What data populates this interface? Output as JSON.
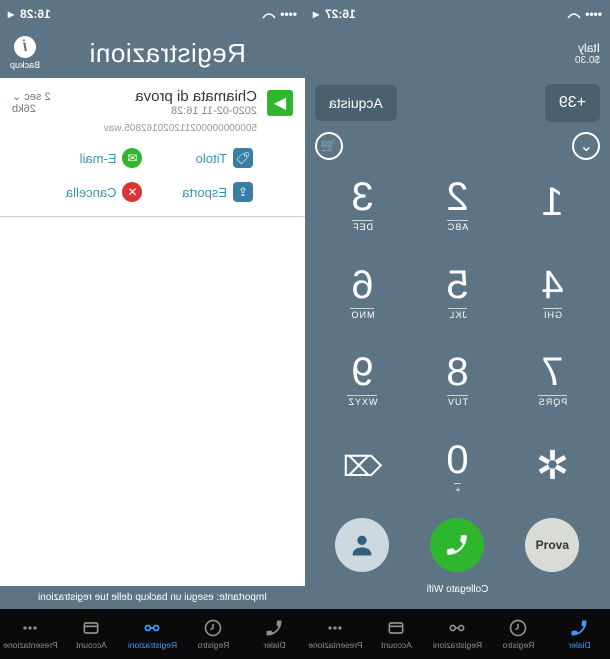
{
  "dialer_screen": {
    "statusbar": {
      "carrier_dots": "•••",
      "wifi": true,
      "time": "16:27",
      "signal": true,
      "battery": true
    },
    "country": "Italy",
    "balance": "$0.30",
    "prefix_btn": "+39",
    "buy_btn": "Acquista",
    "keys": [
      {
        "d": "1",
        "l": ""
      },
      {
        "d": "2",
        "l": "ABC"
      },
      {
        "d": "3",
        "l": "DEF"
      },
      {
        "d": "4",
        "l": "GHI"
      },
      {
        "d": "5",
        "l": "JKL"
      },
      {
        "d": "6",
        "l": "MNO"
      },
      {
        "d": "7",
        "l": "PQRS"
      },
      {
        "d": "8",
        "l": "TUV"
      },
      {
        "d": "9",
        "l": "WXYZ"
      },
      {
        "d": "✲",
        "l": ""
      },
      {
        "d": "0",
        "l": "+"
      },
      {
        "d": "⌫",
        "l": ""
      }
    ],
    "action_prova": "Prova",
    "status_text": "Collegato Wifi",
    "tabs": [
      {
        "label": "Dialer",
        "active": true
      },
      {
        "label": "Registro",
        "active": false
      },
      {
        "label": "Registrazioni",
        "active": false
      },
      {
        "label": "Account",
        "active": false
      },
      {
        "label": "Presentazione",
        "active": false
      }
    ]
  },
  "recordings_screen": {
    "statusbar": {
      "time": "16:28"
    },
    "title": "Registrazioni",
    "backup_label": "Backup",
    "rec": {
      "name": "Chiamata di prova",
      "date": "2020-02-11 16:28",
      "duration": "2 sec",
      "size": "26kb",
      "filename": "500000000002112020162805.wav"
    },
    "actions": {
      "title": "Titolo",
      "email": "E-mail",
      "export": "Esporta",
      "delete": "Cancella"
    },
    "footer_text": "Importante: esegui un backup delle tue registrazioni",
    "tabs": [
      {
        "label": "Dialer",
        "active": false
      },
      {
        "label": "Registro",
        "active": false
      },
      {
        "label": "Registrazioni",
        "active": true
      },
      {
        "label": "Account",
        "active": false
      },
      {
        "label": "Presentazione",
        "active": false
      }
    ]
  }
}
